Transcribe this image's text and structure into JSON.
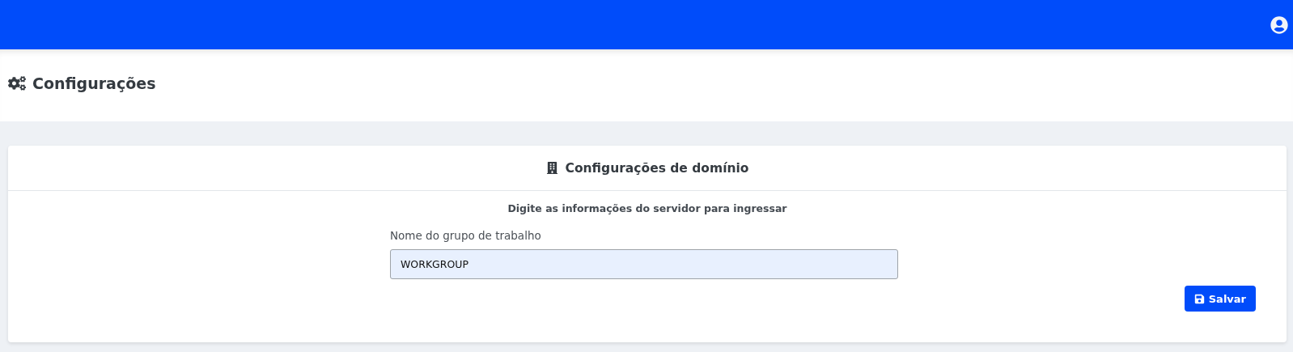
{
  "page": {
    "title": "Configurações"
  },
  "card": {
    "title": "Configurações de domínio",
    "subtitle": "Digite as informações do servidor para ingressar",
    "field": {
      "label": "Nome do grupo de trabalho",
      "value": "WORKGROUP"
    },
    "save_button": "Salvar"
  }
}
